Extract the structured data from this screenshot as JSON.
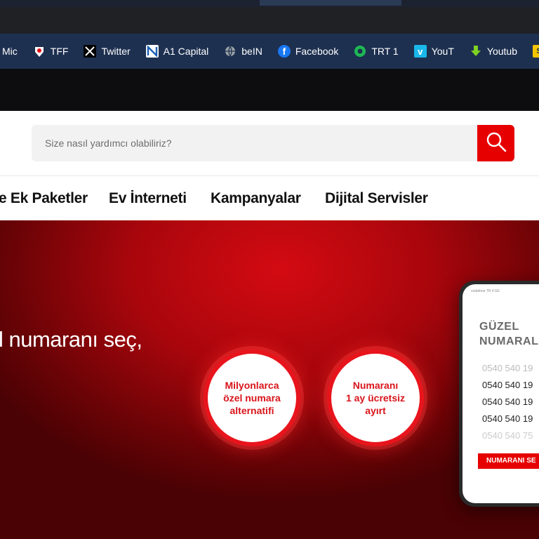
{
  "bookmarks": [
    {
      "label": "Mic",
      "icon": "mic-favicon"
    },
    {
      "label": "TFF",
      "icon": "tff-favicon"
    },
    {
      "label": "Twitter",
      "icon": "x-icon"
    },
    {
      "label": "A1 Capital",
      "icon": "a1-capital-icon"
    },
    {
      "label": "beIN",
      "icon": "globe-icon"
    },
    {
      "label": "Facebook",
      "icon": "facebook-icon"
    },
    {
      "label": "TRT 1",
      "icon": "trt-icon"
    },
    {
      "label": "YouT",
      "icon": "vimeo-icon"
    },
    {
      "label": "Youtub",
      "icon": "download-arrow-icon"
    }
  ],
  "search": {
    "placeholder": "Size nasıl yardımcı olabiliriz?"
  },
  "nav": {
    "ek_paketler": "e Ek Paketler",
    "ev_interneti": "Ev İnterneti",
    "kampanyalar": "Kampanyalar",
    "dijital_servisler": "Dijital Servisler"
  },
  "hero": {
    "title": "l numaranı seç,",
    "circle1": "Milyonlarca\nözel numara\nalternatifi",
    "circle2": "Numaranı\n1 ay ücretsiz\nayırt"
  },
  "phone": {
    "status": "vodafone TR 4.5G",
    "title": "GÜZEL\nNUMARALA",
    "numbers": [
      "0540 540 19",
      "0540 540 19",
      "0540 540 19",
      "0540 540 19",
      "0540 540 75"
    ],
    "button": "NUMARANI SE"
  },
  "colors": {
    "brand_red": "#e60000",
    "bookmarks_bg": "#1e3050"
  }
}
